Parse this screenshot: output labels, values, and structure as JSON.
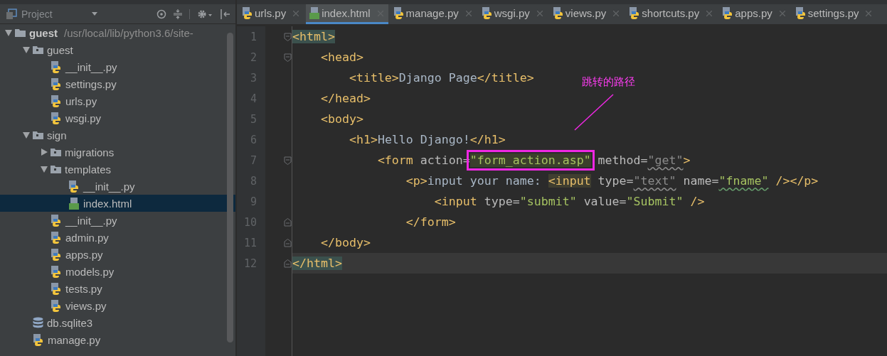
{
  "project_panel": {
    "title": "Project"
  },
  "tree": [
    {
      "label": "guest",
      "path": "/usr/local/lib/python3.6/site-",
      "kind": "root",
      "expanded": true,
      "selected": false,
      "children": [
        {
          "label": "guest",
          "kind": "folder",
          "expanded": true,
          "selected": false,
          "children": [
            {
              "label": "__init__.py",
              "kind": "python",
              "selected": false
            },
            {
              "label": "settings.py",
              "kind": "python",
              "selected": false
            },
            {
              "label": "urls.py",
              "kind": "python",
              "selected": false
            },
            {
              "label": "wsgi.py",
              "kind": "python",
              "selected": false
            }
          ]
        },
        {
          "label": "sign",
          "kind": "folder",
          "expanded": true,
          "selected": false,
          "children": [
            {
              "label": "migrations",
              "kind": "folder",
              "expanded": false,
              "selected": false
            },
            {
              "label": "templates",
              "kind": "folder",
              "expanded": true,
              "selected": false,
              "children": [
                {
                  "label": "__init__.py",
                  "kind": "python",
                  "selected": false
                },
                {
                  "label": "index.html",
                  "kind": "html",
                  "selected": true
                }
              ]
            },
            {
              "label": "__init__.py",
              "kind": "python",
              "selected": false
            },
            {
              "label": "admin.py",
              "kind": "python",
              "selected": false
            },
            {
              "label": "apps.py",
              "kind": "python",
              "selected": false
            },
            {
              "label": "models.py",
              "kind": "python",
              "selected": false
            },
            {
              "label": "tests.py",
              "kind": "python",
              "selected": false
            },
            {
              "label": "views.py",
              "kind": "python",
              "selected": false
            }
          ]
        },
        {
          "label": "db.sqlite3",
          "kind": "database",
          "selected": false
        },
        {
          "label": "manage.py",
          "kind": "python",
          "selected": false
        }
      ]
    }
  ],
  "tabs": [
    {
      "label": "urls.py",
      "kind": "python",
      "selected": false
    },
    {
      "label": "index.html",
      "kind": "html",
      "selected": true
    },
    {
      "label": "manage.py",
      "kind": "python",
      "selected": false
    },
    {
      "label": "wsgi.py",
      "kind": "python",
      "selected": false
    },
    {
      "label": "views.py",
      "kind": "python",
      "selected": false
    },
    {
      "label": "shortcuts.py",
      "kind": "python",
      "selected": false
    },
    {
      "label": "apps.py",
      "kind": "python",
      "selected": false
    },
    {
      "label": "settings.py",
      "kind": "python",
      "selected": false
    }
  ],
  "code_lines": [
    {
      "number": "1",
      "current": false,
      "fold_start": true,
      "fold_end": false,
      "tokens": [
        {
          "kind": "tag-match",
          "text": "<html>"
        }
      ]
    },
    {
      "number": "2",
      "current": false,
      "fold_start": true,
      "fold_end": false,
      "tokens": [
        {
          "kind": "tag",
          "text": "    <head>"
        }
      ]
    },
    {
      "number": "3",
      "current": false,
      "fold_start": false,
      "fold_end": false,
      "tokens": [
        {
          "kind": "tag",
          "text": "        <title>"
        },
        {
          "kind": "text",
          "text": "Django Page"
        },
        {
          "kind": "tag",
          "text": "</title>"
        }
      ]
    },
    {
      "number": "4",
      "current": false,
      "fold_start": false,
      "fold_end": false,
      "tokens": [
        {
          "kind": "tag",
          "text": "    </head>"
        }
      ]
    },
    {
      "number": "5",
      "current": false,
      "fold_start": false,
      "fold_end": false,
      "tokens": [
        {
          "kind": "tag",
          "text": "    <body>"
        }
      ]
    },
    {
      "number": "6",
      "current": false,
      "fold_start": false,
      "fold_end": false,
      "tokens": [
        {
          "kind": "tag",
          "text": "        <h1>"
        },
        {
          "kind": "text",
          "text": "Hello Django!"
        },
        {
          "kind": "tag",
          "text": "</h1>"
        }
      ]
    },
    {
      "number": "7",
      "current": false,
      "fold_start": true,
      "fold_end": false,
      "tokens": [
        {
          "kind": "tag",
          "text": "            <form"
        },
        {
          "kind": "attr",
          "text": " action="
        },
        {
          "kind": "string-annotated",
          "text": "\"form_action.asp\""
        },
        {
          "kind": "attr",
          "text": " method="
        },
        {
          "kind": "string-warn",
          "text": "\"get\""
        },
        {
          "kind": "tag",
          "text": ">"
        }
      ]
    },
    {
      "number": "8",
      "current": false,
      "fold_start": false,
      "fold_end": false,
      "tokens": [
        {
          "kind": "tag",
          "text": "                <p>"
        },
        {
          "kind": "text",
          "text": "input your name: "
        },
        {
          "kind": "tag-highlight",
          "text": "<input"
        },
        {
          "kind": "attr",
          "text": " type="
        },
        {
          "kind": "string-warn",
          "text": "\"text\""
        },
        {
          "kind": "attr",
          "text": " name="
        },
        {
          "kind": "string-typo",
          "text": "\"fname\""
        },
        {
          "kind": "tag",
          "text": " /></p>"
        }
      ]
    },
    {
      "number": "9",
      "current": false,
      "fold_start": false,
      "fold_end": false,
      "tokens": [
        {
          "kind": "tag",
          "text": "                    <input"
        },
        {
          "kind": "attr",
          "text": " type="
        },
        {
          "kind": "string",
          "text": "\"submit\""
        },
        {
          "kind": "attr",
          "text": " value="
        },
        {
          "kind": "string",
          "text": "\"Submit\""
        },
        {
          "kind": "tag",
          "text": " />"
        }
      ]
    },
    {
      "number": "10",
      "current": false,
      "fold_start": false,
      "fold_end": true,
      "tokens": [
        {
          "kind": "tag",
          "text": "                </form>"
        }
      ]
    },
    {
      "number": "11",
      "current": false,
      "fold_start": false,
      "fold_end": true,
      "tokens": [
        {
          "kind": "tag",
          "text": "    </body>"
        }
      ]
    },
    {
      "number": "12",
      "current": true,
      "fold_start": false,
      "fold_end": true,
      "tokens": [
        {
          "kind": "tag-match",
          "text": "</html>"
        }
      ]
    }
  ],
  "annotation": {
    "text": "跳转的路径"
  }
}
